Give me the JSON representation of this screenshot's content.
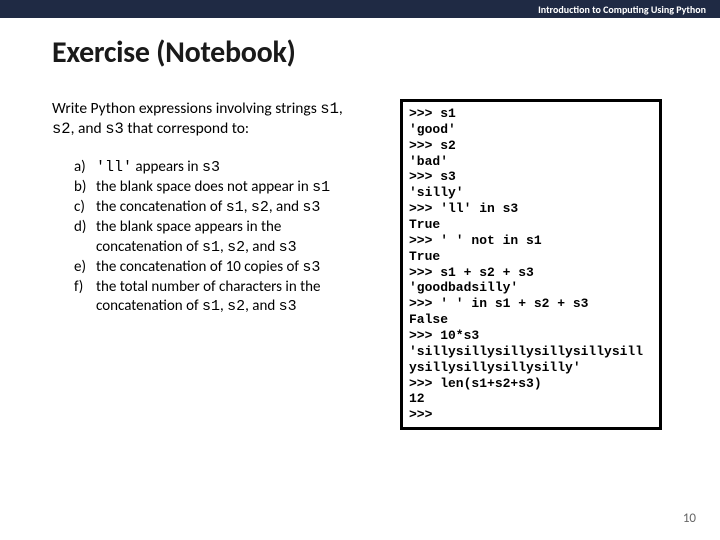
{
  "header": {
    "course": "Introduction to Computing Using Python"
  },
  "title": "Exercise (Notebook)",
  "intro": {
    "pre": "Write Python expressions involving strings ",
    "s1": "s1",
    "c1": ", ",
    "s2": "s2",
    "c2": ", and ",
    "s3": "s3",
    "post": " that correspond to:"
  },
  "items": {
    "a": {
      "label": "a)",
      "t1": "'ll'",
      "t2": " appears in ",
      "t3": "s3"
    },
    "b": {
      "label": "b)",
      "t1": "the blank space does not appear in ",
      "t2": "s1"
    },
    "c": {
      "label": "c)",
      "t1": "the concatenation of ",
      "t2": "s1",
      "t3": ", ",
      "t4": "s2",
      "t5": ", and ",
      "t6": "s3"
    },
    "d": {
      "label": "d)",
      "t1": "the blank space appears in the concatenation of ",
      "t2": "s1",
      "t3": ", ",
      "t4": "s2",
      "t5": ", and ",
      "t6": "s3"
    },
    "e": {
      "label": "e)",
      "t1": "the concatenation of 10 copies of ",
      "t2": "s3"
    },
    "f": {
      "label": "f)",
      "t1": "the total number of characters in the concatenation of ",
      "t2": "s1",
      "t3": ", ",
      "t4": "s2",
      "t5": ", and ",
      "t6": "s3"
    }
  },
  "code": ">>> s1\n'good'\n>>> s2\n'bad'\n>>> s3\n'silly'\n>>> 'll' in s3\nTrue\n>>> ' ' not in s1\nTrue\n>>> s1 + s2 + s3\n'goodbadsilly'\n>>> ' ' in s1 + s2 + s3\nFalse\n>>> 10*s3\n'sillysillysillysillysillysill\nysillysillysillysilly'\n>>> len(s1+s2+s3)\n12\n>>>",
  "page_num": "10"
}
